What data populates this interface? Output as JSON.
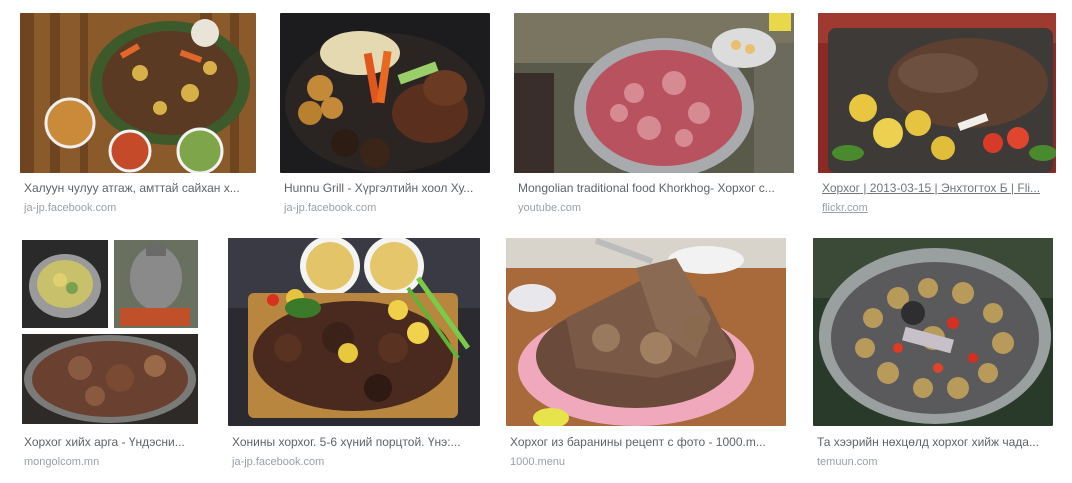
{
  "results": [
    {
      "title": "Халуун чулуу атгаж, амттай сайхан х...",
      "source": "ja-jp.facebook.com",
      "image": "food-on-wooden-table-image"
    },
    {
      "title": "Hunnu Grill - Хүргэлтийн хоол Ху...",
      "source": "ja-jp.facebook.com",
      "image": "grilled-meat-platter-image"
    },
    {
      "title": "Mongolian traditional food Khorkhog- Хорхог с...",
      "source": "youtube.com",
      "image": "raw-meat-pot-image"
    },
    {
      "title": "Хорхог | 2013-03-15 | Энхтогтох Б | Fli...",
      "source": "flickr.com",
      "image": "meat-vegetable-tray-image"
    },
    {
      "title": "Хорхог хийх арга - Үндэсни...",
      "source": "mongolcom.mn",
      "image": "khorkhog-collage-image"
    },
    {
      "title": "Хонины хорхог. 5-6 хүний порцтой. Үнэ:...",
      "source": "ja-jp.facebook.com",
      "image": "lamb-board-with-soup-image"
    },
    {
      "title": "Хорхог из баранины рецепт с фото - 1000.m...",
      "source": "1000.menu",
      "image": "lamb-in-pink-bowl-image"
    },
    {
      "title": "Та хээрийн нөхцөлд хорхог хийж чада...",
      "source": "temuun.com",
      "image": "potatoes-in-pot-image"
    }
  ]
}
